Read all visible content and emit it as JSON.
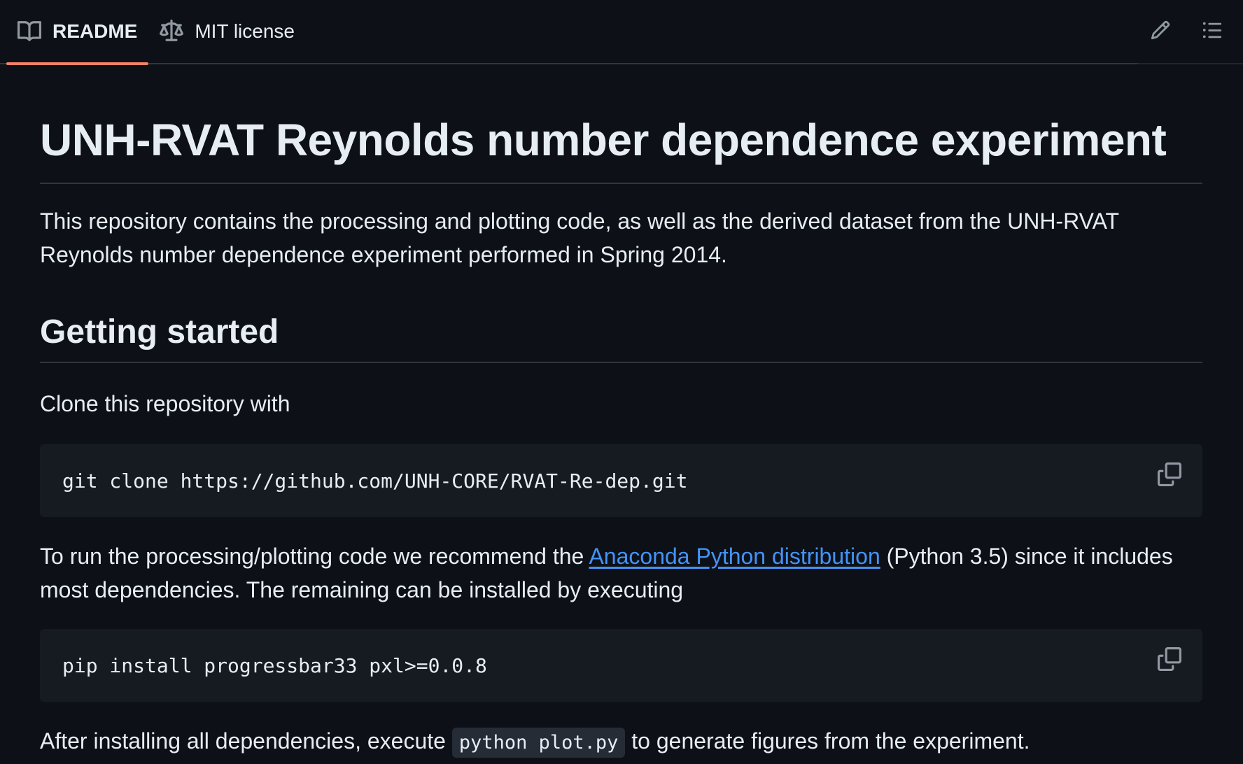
{
  "tabs": [
    {
      "label": "README",
      "icon": "book-icon",
      "active": true
    },
    {
      "label": "MIT license",
      "icon": "law-scale-icon",
      "active": false
    }
  ],
  "actions": {
    "edit_icon": "pencil-icon",
    "outline_icon": "list-icon"
  },
  "readme": {
    "title": "UNH-RVAT Reynolds number dependence experiment",
    "intro": "This repository contains the processing and plotting code, as well as the derived dataset from the UNH-RVAT Reynolds number dependence experiment performed in Spring 2014.",
    "section_heading": "Getting started",
    "clone_text": "Clone this repository with",
    "clone_command": "git clone https://github.com/UNH-CORE/RVAT-Re-dep.git",
    "run_text_before": "To run the processing/plotting code we recommend the ",
    "run_link": "Anaconda Python distribution",
    "run_text_after": " (Python 3.5) since it includes most dependencies. The remaining can be installed by executing",
    "pip_command": "pip install progressbar33 pxl>=0.0.8",
    "after_before": "After installing all dependencies, execute ",
    "after_code": "python plot.py",
    "after_after": " to generate figures from the experiment."
  },
  "colors": {
    "background": "#0d1117",
    "text": "#e6edf3",
    "accent_underline": "#f78166",
    "link": "#4493f8",
    "code_bg": "#161b22"
  }
}
